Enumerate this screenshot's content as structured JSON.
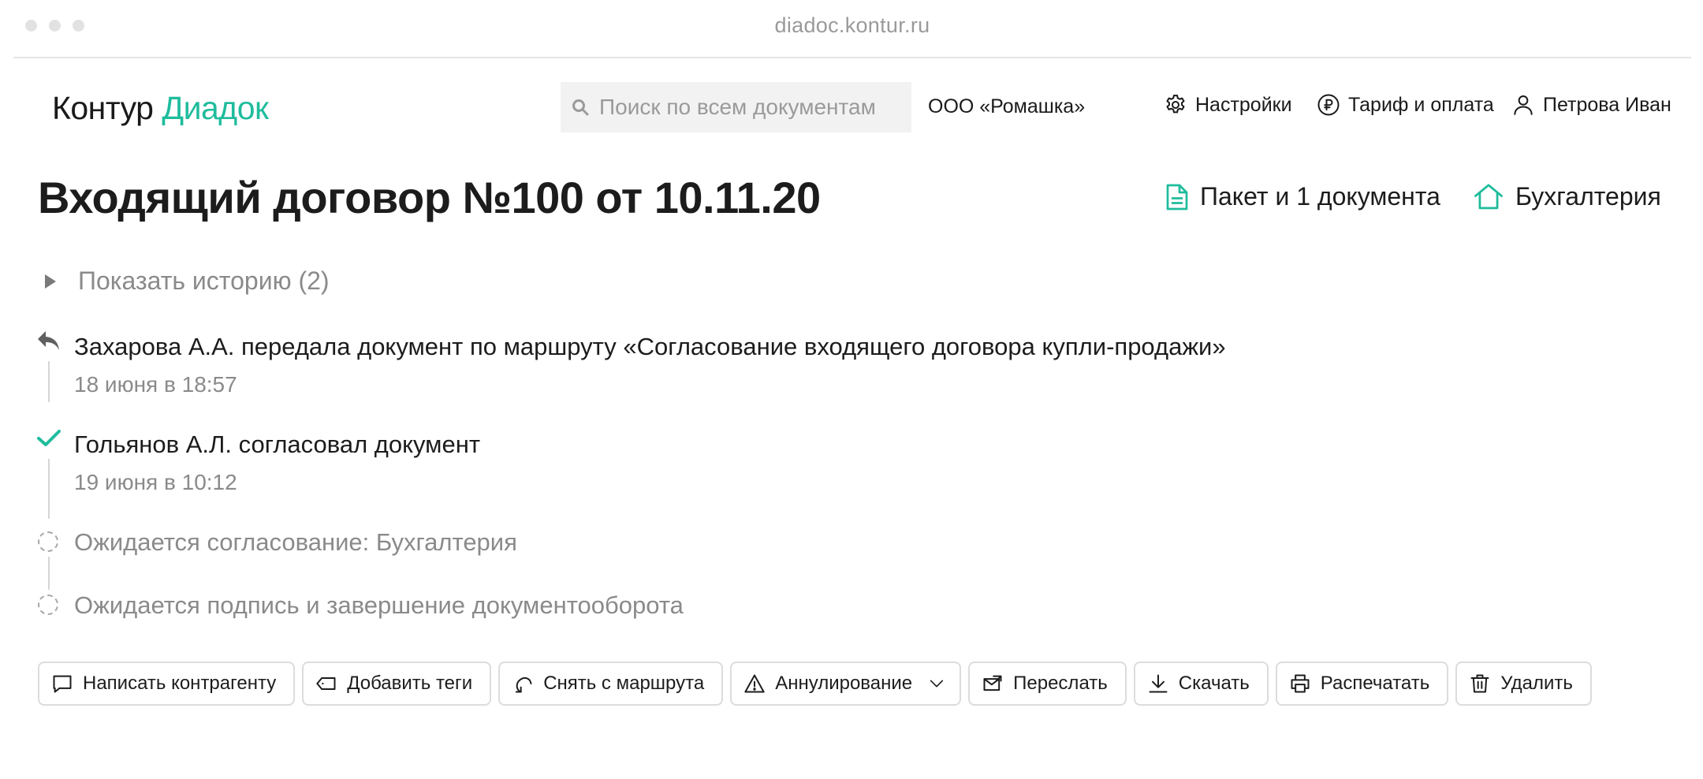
{
  "browser": {
    "url": "diadoc.kontur.ru"
  },
  "header": {
    "logo_part1": "Контур",
    "logo_part2": "Диадок",
    "search_placeholder": "Поиск по всем документам",
    "organization": "ООО «Ромашка»",
    "settings_label": "Настройки",
    "tariff_label": "Тариф и оплата",
    "user_name": "Петрова Иван"
  },
  "document": {
    "title": "Входящий договор №100 от 10.11.20",
    "package_label": "Пакет и 1 документа",
    "department_label": "Бухгалтерия"
  },
  "history": {
    "toggle_label": "Показать историю (2)",
    "events": [
      {
        "text": "Захарова А.А. передала документ по маршруту «Согласование входящего договора купли-продажи»",
        "date": "18 июня в 18:57",
        "icon": "forward-arrow-icon"
      },
      {
        "text": "Гольянов А.Л. согласовал документ",
        "date": "19 июня в 10:12",
        "icon": "checkmark-icon"
      },
      {
        "text": "Ожидается согласование: Бухгалтерия",
        "icon": "pending-circle-icon"
      },
      {
        "text": "Ожидается подпись и завершение документооборота",
        "icon": "pending-circle-icon"
      }
    ]
  },
  "actions": {
    "write": "Написать контрагенту",
    "tags": "Добавить теги",
    "unroute": "Снять с маршрута",
    "annul": "Аннулирование",
    "forward": "Переслать",
    "download": "Скачать",
    "print": "Распечатать",
    "delete": "Удалить"
  },
  "colors": {
    "accent": "#1fbc9c",
    "text": "#1c1c1c",
    "muted": "#8a8a8a",
    "border": "#dcdcdc"
  }
}
